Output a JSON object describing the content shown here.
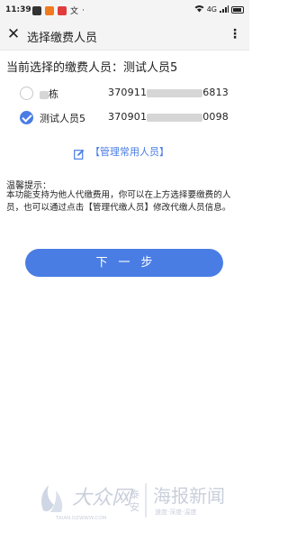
{
  "status_bar": {
    "time": "11:39",
    "apps": [
      {
        "icon": "msg-app-icon",
        "color": "#333333"
      },
      {
        "icon": "orange-app-icon",
        "color": "#f07a1e"
      },
      {
        "icon": "red-app-icon",
        "color": "#e23b3b"
      },
      {
        "icon": "translate-icon",
        "color": "#333333"
      },
      {
        "icon": "dot-icon",
        "color": "#333333"
      }
    ],
    "network": "4G",
    "signal": "46"
  },
  "nav": {
    "close_icon": "close-icon",
    "title": "选择缴费人员",
    "more_icon": "more-icon"
  },
  "current": {
    "label": "当前选择的缴费人员：测试人员5"
  },
  "payers": [
    {
      "name": "栋",
      "id_prefix": "370911",
      "id_suffix": "6813",
      "checked": false
    },
    {
      "name": "测试人员5",
      "id_prefix": "370901",
      "id_suffix": "0098",
      "checked": true
    }
  ],
  "manage": {
    "label": "【管理常用人员】"
  },
  "tips": {
    "title": "温馨提示：",
    "body": "本功能支持为他人代缴费用，你可以在上方选择要缴费的人员，也可以通过点击【管理代缴人员】修改代缴人员信息。"
  },
  "next_button": {
    "label": "下一步"
  },
  "watermark": {
    "logo_text": "大众网",
    "logo_sub": "泰安",
    "site": "TAIAN.DZWWW.COM",
    "slogan": "海报新闻",
    "slogan_sub": "速度·深度·温度"
  },
  "colors": {
    "accent": "#4a7de4",
    "bar_bg": "#f4f4f4"
  }
}
